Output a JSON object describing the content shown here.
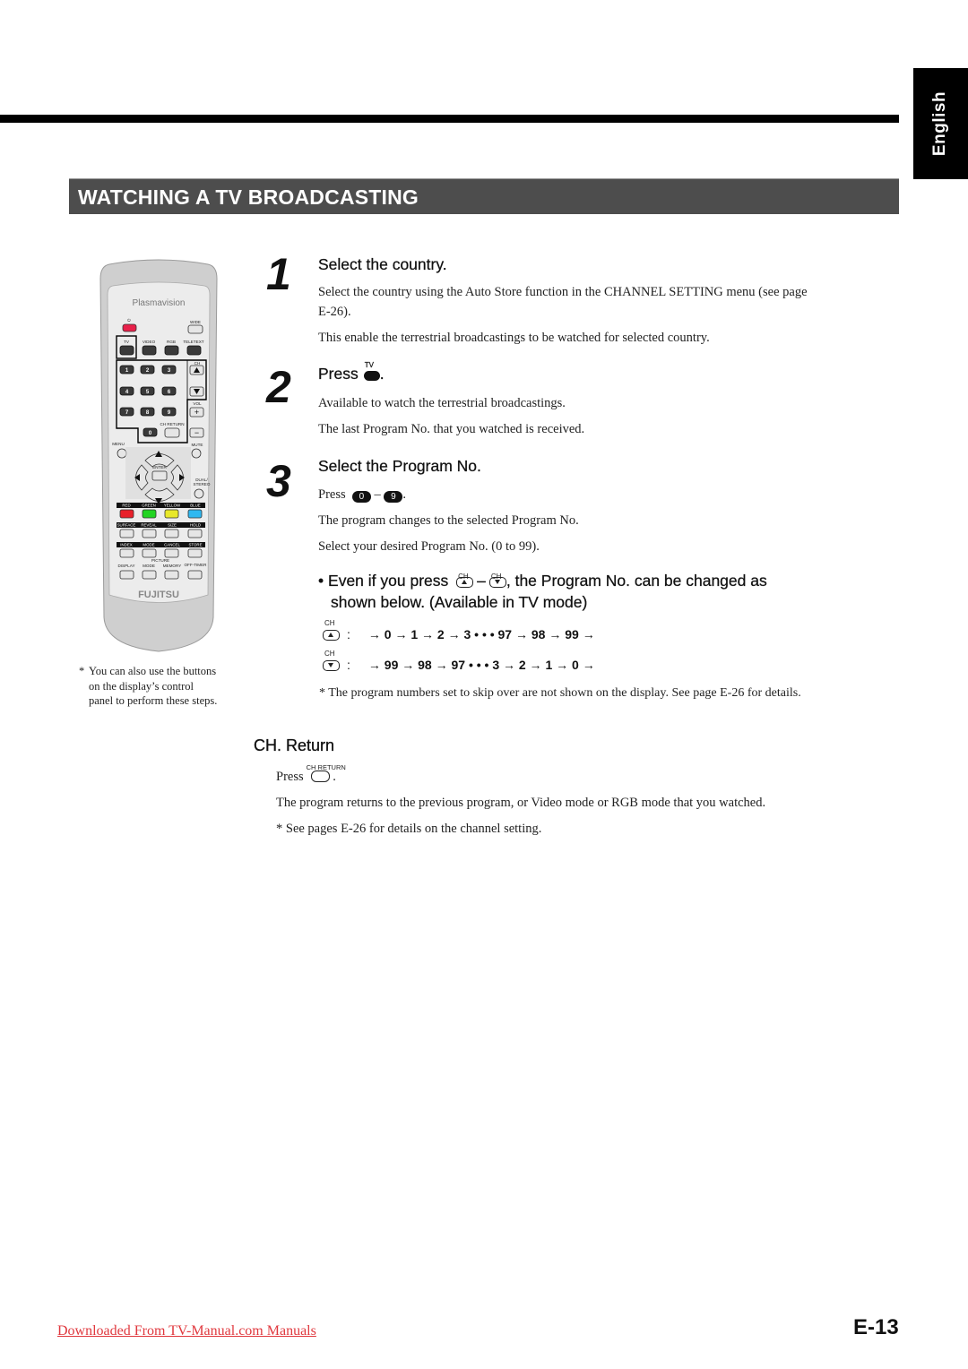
{
  "language_tab": "English",
  "section_title": "WATCHING A TV BROADCASTING",
  "remote": {
    "brand_top": "Plasmavision",
    "brand_bottom": "FUJITSU",
    "labels": {
      "power": "⏻",
      "wide": "WIDE",
      "tv": "TV",
      "video": "VIDEO",
      "rgb": "RGB",
      "teletext": "TELETEXT",
      "ch": "CH",
      "vol": "VOL",
      "ch_return": "CH RETURN",
      "menu": "MENU",
      "mute": "MUTE",
      "enter": "ENTER",
      "dual_stereo_1": "DUAL/",
      "dual_stereo_2": "STEREO",
      "red": "RED",
      "green": "GREEN",
      "yellow": "YELLOW",
      "blue": "BLUE",
      "surface": "SURFACE",
      "reveal": "REVEAL",
      "size": "SIZE",
      "hold": "HOLD",
      "index": "INDEX",
      "mode": "MODE",
      "cancel": "CANCEL",
      "store": "STORE",
      "display": "DISPLAY",
      "picture": "PICTURE",
      "picture_mode": "MODE",
      "memory": "MEMORY",
      "off_timer": "OFF-TIMER"
    },
    "digits": [
      "1",
      "2",
      "3",
      "4",
      "5",
      "6",
      "7",
      "8",
      "9",
      "0"
    ],
    "colors": {
      "red": "#e8202a",
      "green": "#22d422",
      "yellow": "#e8e82a",
      "blue": "#30b8f0",
      "power": "#e8204a"
    }
  },
  "remote_caption": {
    "asterisk": "*",
    "lines": [
      "You can also use the buttons",
      "on the display’s control",
      "panel to perform these steps."
    ]
  },
  "steps": [
    {
      "number": "1",
      "title": "Select the country.",
      "paragraphs": [
        "Select the country using the Auto Store function in the CHANNEL SETTING menu (see page",
        "E-26).",
        "This enable the terrestrial broadcastings to be watched for selected country."
      ]
    },
    {
      "number": "2",
      "title_prefix": "Press",
      "title_key_label": "TV",
      "title_suffix": ".",
      "paragraphs": [
        "Available to watch the terrestrial broadcastings.",
        "The last Program No. that you watched is received."
      ]
    },
    {
      "number": "3",
      "title": "Select the Program No.",
      "press_prefix": "Press",
      "key_from": "0",
      "dash": "–",
      "key_to": "9",
      "press_suffix": ".",
      "paragraphs": [
        "The program changes to the selected Program No.",
        "Select your desired Program No. (0 to 99)."
      ]
    }
  ],
  "bullet": {
    "dot": "•",
    "part1": "Even if you press",
    "key_label": "CH",
    "dash": "–",
    "part2": ", the Program No. can be changed as",
    "line2": "shown below. (Available in TV mode)"
  },
  "sequences": {
    "up_label": "CH",
    "up_colon": ":",
    "up_sequence": "→ 0 → 1 → 2 → 3 • • • 97 → 98 → 99 →",
    "down_label": "CH",
    "down_colon": ":",
    "down_sequence": "→ 99 → 98 → 97 • • • 3 → 2 → 1 → 0 →"
  },
  "skip_note": "* The program numbers set to skip over are not shown on the display. See page E-26 for details.",
  "ch_return": {
    "heading": "CH. Return",
    "press_prefix": "Press",
    "key_label": "CH RETURN",
    "press_suffix": ".",
    "description": "The program returns to the previous program, or Video mode or RGB mode that you watched.",
    "note": "* See pages E-26 for details on the channel setting."
  },
  "footer": {
    "link_text": "Downloaded From TV-Manual.com Manuals",
    "page_number": "E-13"
  }
}
